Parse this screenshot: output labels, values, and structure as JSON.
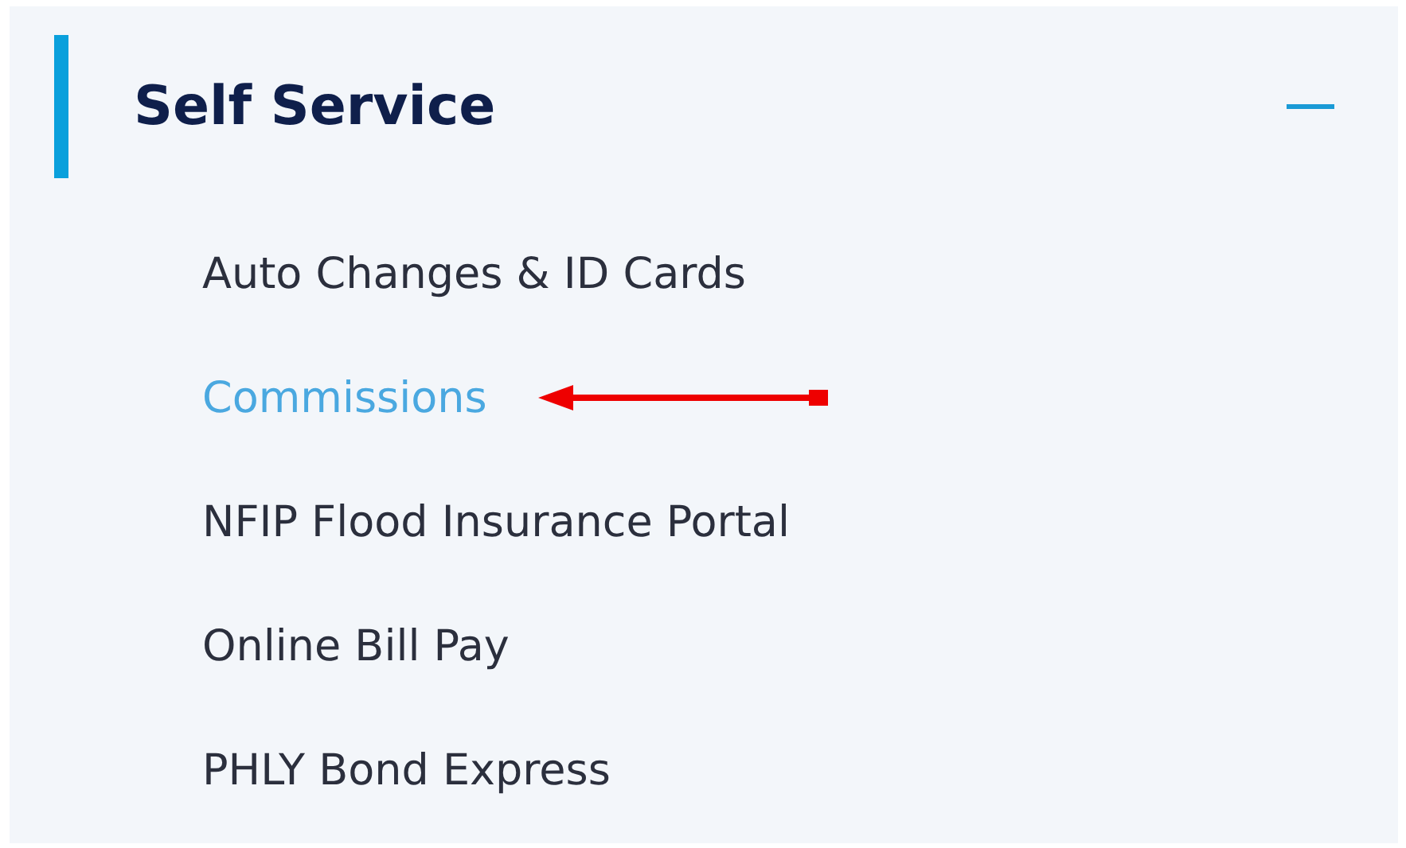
{
  "section": {
    "title": "Self Service",
    "expanded": true,
    "items": [
      {
        "label": "Auto Changes & ID Cards",
        "selected": false
      },
      {
        "label": "Commissions",
        "selected": true
      },
      {
        "label": "NFIP Flood Insurance Portal",
        "selected": false
      },
      {
        "label": "Online Bill Pay",
        "selected": false
      },
      {
        "label": "PHLY Bond Express",
        "selected": false
      }
    ]
  }
}
